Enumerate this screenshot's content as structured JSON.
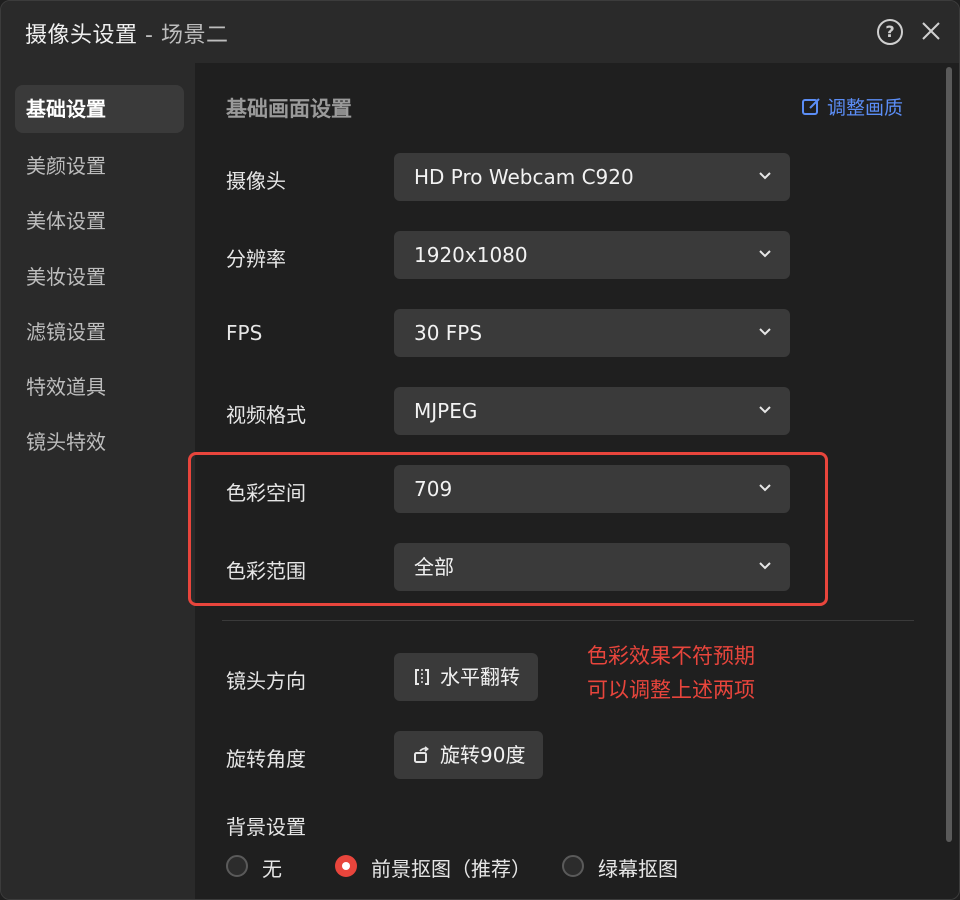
{
  "window": {
    "title": "摄像头设置",
    "title_sep": " - ",
    "subtitle": "场景二"
  },
  "titlebar": {
    "help_label": "?"
  },
  "sidebar": {
    "items": [
      {
        "label": "基础设置",
        "active": true
      },
      {
        "label": "美颜设置"
      },
      {
        "label": "美体设置"
      },
      {
        "label": "美妆设置"
      },
      {
        "label": "滤镜设置"
      },
      {
        "label": "特效道具"
      },
      {
        "label": "镜头特效"
      }
    ]
  },
  "main": {
    "section_title": "基础画面设置",
    "adjust_link": "调整画质",
    "fields": [
      {
        "label": "摄像头",
        "value": "HD Pro Webcam C920"
      },
      {
        "label": "分辨率",
        "value": "1920x1080"
      },
      {
        "label": "FPS",
        "value": "30 FPS"
      },
      {
        "label": "视频格式",
        "value": "MJPEG"
      },
      {
        "label": "色彩空间",
        "value": "709"
      },
      {
        "label": "色彩范围",
        "value": "全部"
      }
    ],
    "lens_direction": {
      "label": "镜头方向",
      "button": "水平翻转"
    },
    "rotation": {
      "label": "旋转角度",
      "button": "旋转90度"
    },
    "note_lines": [
      "色彩效果不符预期",
      "可以调整上述两项"
    ],
    "background": {
      "label": "背景设置",
      "options": [
        "无",
        "前景抠图（推荐）",
        "绿幕抠图"
      ],
      "selected": "前景抠图（推荐）"
    }
  },
  "colors": {
    "accent_red": "#e8453c",
    "link_blue": "#5b8df5"
  }
}
